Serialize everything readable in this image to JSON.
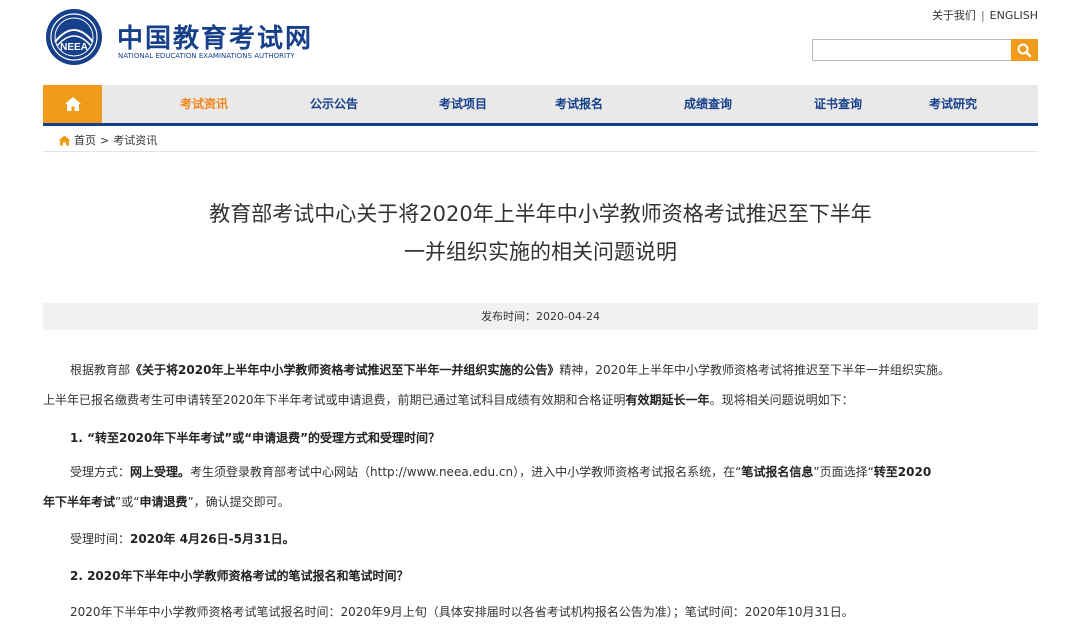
{
  "header": {
    "logo_cn": "中国教育考试网",
    "logo_en": "NATIONAL EDUCATION EXAMINATIONS AUTHORITY",
    "logo_mark": "NEEA",
    "about_link": "关于我们",
    "separator": "|",
    "english_link": "ENGLISH",
    "search_placeholder": ""
  },
  "nav": {
    "items": [
      {
        "label": "考试资讯",
        "active": true
      },
      {
        "label": "公示公告"
      },
      {
        "label": "考试项目"
      },
      {
        "label": "考试报名"
      },
      {
        "label": "成绩查询"
      },
      {
        "label": "证书查询"
      },
      {
        "label": "考试研究"
      }
    ]
  },
  "breadcrumb": {
    "home": "首页",
    "sep": ">",
    "current": "考试资讯"
  },
  "article": {
    "title_line1": "教育部考试中心关于将2020年上半年中小学教师资格考试推迟至下半年",
    "title_line2": "一并组织实施的相关问题说明",
    "pub_label": "发布时间：",
    "pub_date": "2020-04-24",
    "p1a": "根据教育部",
    "p1b": "《关于将2020年上半年中小学教师资格考试推迟至下半年一并组织实施的公告》",
    "p1c": "精神，2020年上半年中小学教师资格考试将推迟至下半年一并组织实施。",
    "p2a": "上半年已报名缴费考生可申请转至2020年下半年考试或申请退费，前期已通过笔试科目成绩有效期和合格证明",
    "p2b": "有效期延长一年",
    "p2c": "。现将相关问题说明如下：",
    "h1": "1. “转至2020年下半年考试”或“申请退费”的受理方式和受理时间？",
    "p3a": "受理方式：",
    "p3b": "网上受理。",
    "p3c": "考生须登录教育部考试中心网站（http://www.neea.edu.cn），进入中小学教师资格考试报名系统，在“",
    "p3d": "笔试报名信息",
    "p3e": "”页面选择“",
    "p3f": "转至2020",
    "p4a": "年下半年考试",
    "p4b": "”或“",
    "p4c": "申请退费",
    "p4d": "”，确认提交即可。",
    "p5a": "受理时间：",
    "p5b": "2020年 4月26日-5月31日。",
    "h2": "2. 2020年下半年中小学教师资格考试的笔试报名和笔试时间？",
    "p6": "2020年下半年中小学教师资格考试笔试报名时间：2020年9月上旬（具体安排届时以各省考试机构报名公告为准）；笔试时间：2020年10月31日。"
  },
  "colors": {
    "brand_blue": "#17408b",
    "accent_orange": "#f19b1c",
    "active_nav": "#f08519"
  }
}
